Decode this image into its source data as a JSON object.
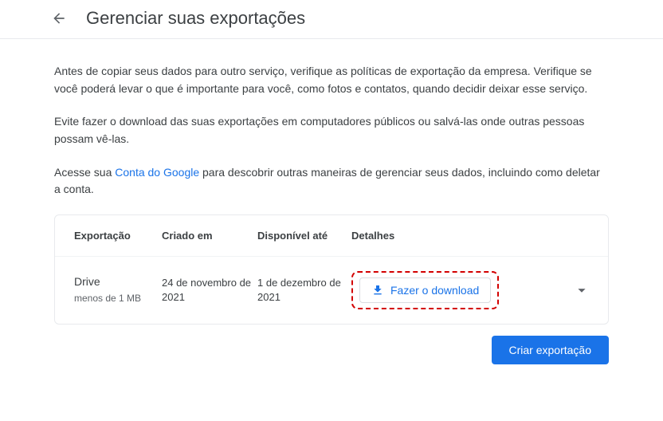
{
  "header": {
    "title": "Gerenciar suas exportações"
  },
  "intro": {
    "p1": "Antes de copiar seus dados para outro serviço, verifique as políticas de exportação da empresa. Verifique se você poderá levar o que é importante para você, como fotos e contatos, quando decidir deixar esse serviço.",
    "p2": "Evite fazer o download das suas exportações em computadores públicos ou salvá-las onde outras pessoas possam vê-las.",
    "p3_a": "Acesse sua ",
    "p3_link": "Conta do Google",
    "p3_b": " para descobrir outras maneiras de gerenciar seus dados, incluindo como deletar a conta."
  },
  "table": {
    "headers": {
      "export": "Exportação",
      "created": "Criado em",
      "available": "Disponível até",
      "details": "Detalhes"
    },
    "row": {
      "name": "Drive",
      "size": "menos de 1 MB",
      "created": "24 de novembro de 2021",
      "available": "1 de dezembro de 2021",
      "download_label": "Fazer o download"
    }
  },
  "actions": {
    "create": "Criar exportação"
  }
}
